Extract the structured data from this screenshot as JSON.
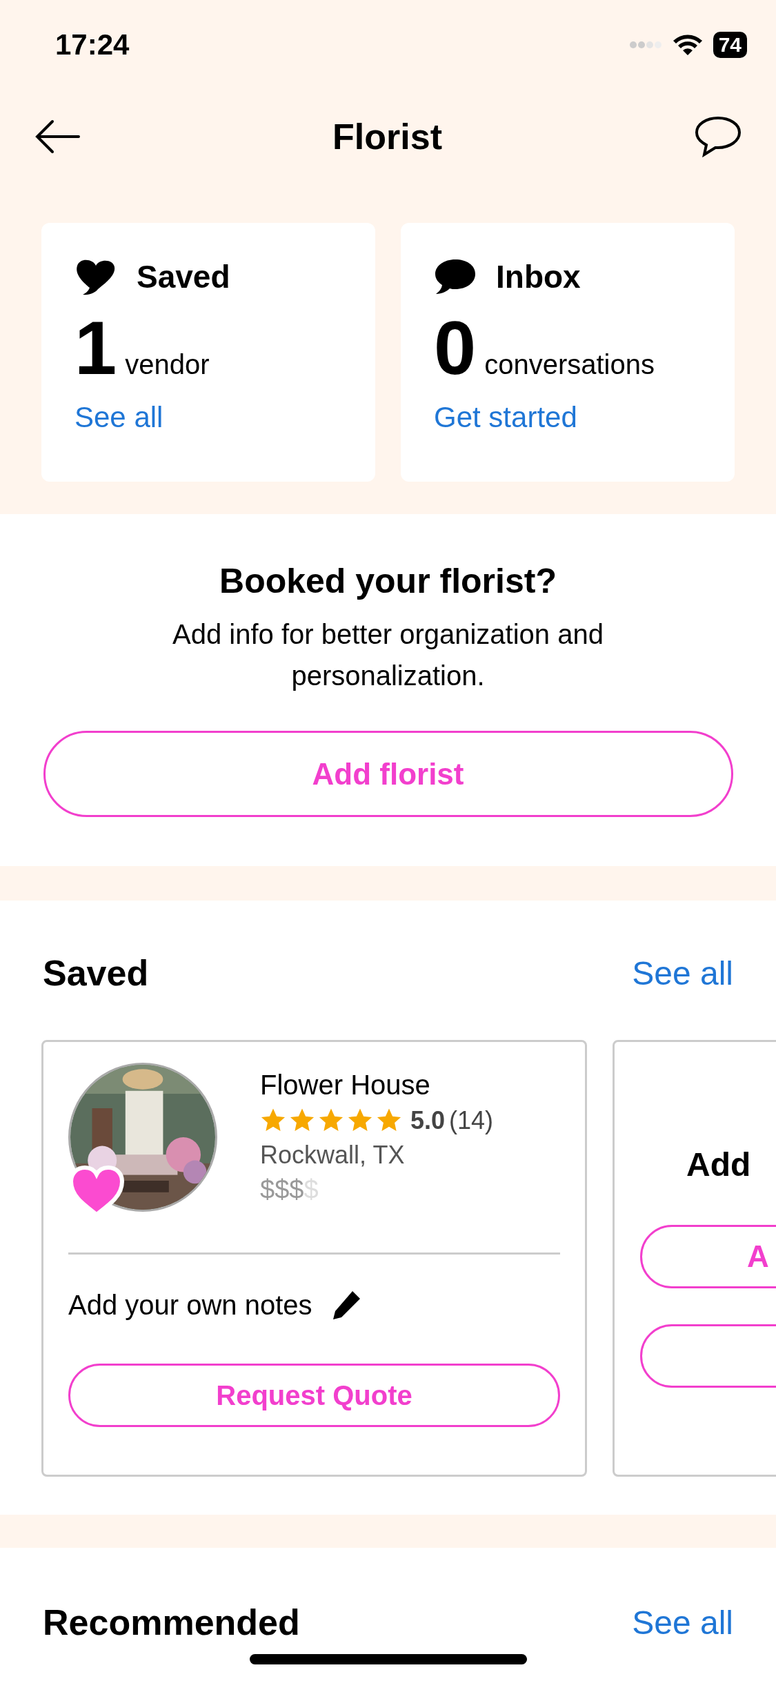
{
  "status_bar": {
    "time": "17:24",
    "battery": "74"
  },
  "header": {
    "title": "Florist"
  },
  "summary_cards": [
    {
      "kind": "saved",
      "title": "Saved",
      "count": "1",
      "unit": "vendor",
      "link": "See all"
    },
    {
      "kind": "inbox",
      "title": "Inbox",
      "count": "0",
      "unit": "conversations",
      "link": "Get started"
    }
  ],
  "booked_prompt": {
    "heading": "Booked your florist?",
    "body": "Add info for better organization and personalization.",
    "button": "Add florist"
  },
  "saved_section": {
    "heading": "Saved",
    "link": "See all",
    "vendor": {
      "name": "Flower House",
      "stars": 5,
      "rating": "5.0",
      "reviews": "(14)",
      "location": "Rockwall, TX",
      "price_active": "$$$",
      "price_inactive": "$",
      "saved": true,
      "notes_label": "Add your own notes",
      "button": "Request Quote"
    },
    "next_card": {
      "title": "Add",
      "button": "A"
    }
  },
  "recommended_section": {
    "heading": "Recommended",
    "link": "See all"
  }
}
